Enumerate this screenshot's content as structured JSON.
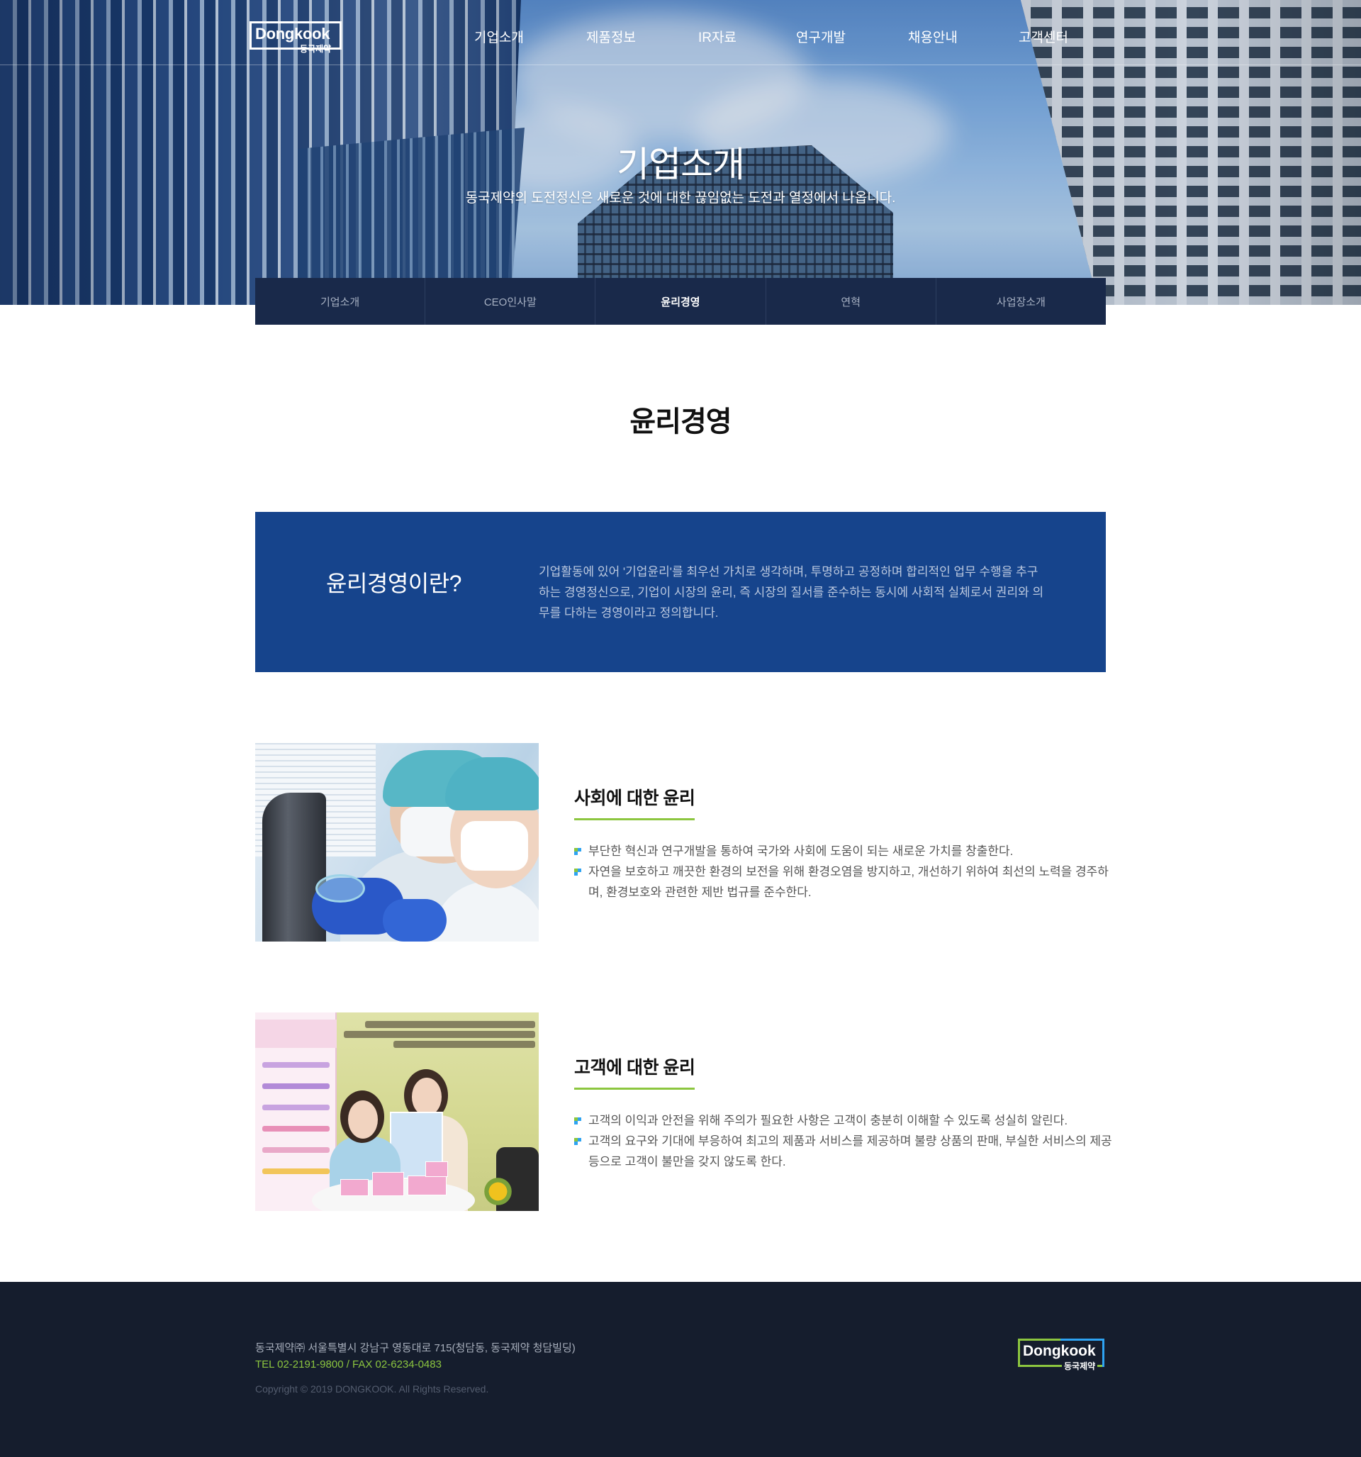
{
  "header": {
    "logo_en": "Dongkook",
    "logo_ko": "동국제약",
    "menu": [
      "기업소개",
      "제품정보",
      "IR자료",
      "연구개발",
      "채용안내",
      "고객센터"
    ]
  },
  "hero": {
    "title": "기업소개",
    "subtitle": "동국제약의 도전정신은 새로운 것에 대한 끊임없는 도전과 열정에서 나옵니다."
  },
  "tabs": {
    "items": [
      "기업소개",
      "CEO인사말",
      "윤리경영",
      "연혁",
      "사업장소개"
    ],
    "active": "윤리경영"
  },
  "page": {
    "title": "윤리경영"
  },
  "intro": {
    "title": "윤리경영이란?",
    "text": "기업활동에 있어 '기업윤리'를 최우선 가치로 생각하며, 투명하고 공정하며 합리적인 업무 수행을 추구하는 경영정신으로, 기업이 시장의 윤리, 즉 시장의 질서를 준수하는 동시에 사회적 실체로서 권리와 의무를 다하는 경영이라고 정의합니다."
  },
  "sections": [
    {
      "title": "사회에 대한 윤리",
      "items": [
        "부단한 혁신과 연구개발을 통하여 국가와 사회에 도움이 되는 새로운 가치를 창출한다.",
        "자연을 보호하고 깨끗한 환경의 보전을 위해 환경오염을 방지하고, 개선하기 위하여 최선의 노력을 경주하며, 환경보호와 관련한 제반 법규를 준수한다."
      ]
    },
    {
      "title": "고객에 대한 윤리",
      "items": [
        "고객의 이익과 안전을 위해 주의가 필요한 사항은 고객이 충분히 이해할 수 있도록 성실히 알린다.",
        "고객의 요구와 기대에 부응하여 최고의 제품과 서비스를 제공하며 불량 상품의 판매, 부실한 서비스의 제공 등으로 고객이 불만을 갖지 않도록 한다."
      ]
    }
  ],
  "footer": {
    "address": "동국제약㈜ 서울특별시 강남구 영동대로 715(청담동, 동국제약 청담빌딩)",
    "tel_fax": "TEL 02-2191-9800 / FAX 02-6234-0483",
    "copyright": "Copyright © 2019 DONGKOOK. All Rights Reserved.",
    "logo_en": "Dongkook",
    "logo_ko": "동국제약"
  },
  "colors": {
    "tab_bar": "#19294a",
    "intro_box": "#16448c",
    "accent_green": "#8cc63f",
    "footer_bg": "#151d2d"
  }
}
